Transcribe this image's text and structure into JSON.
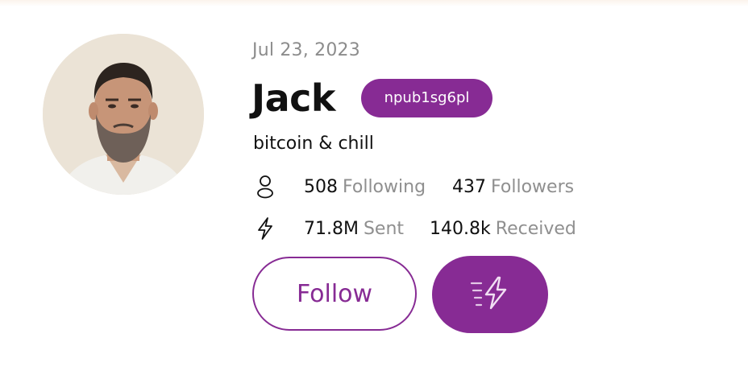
{
  "profile": {
    "date": "Jul 23, 2023",
    "name": "Jack",
    "npub": "npub1sg6pl",
    "bio": "bitcoin & chill"
  },
  "stats": {
    "following_count": "508",
    "following_label": "Following",
    "followers_count": "437",
    "followers_label": "Followers",
    "sent_amount": "71.8M",
    "sent_label": "Sent",
    "received_amount": "140.8k",
    "received_label": "Received"
  },
  "actions": {
    "follow_label": "Follow"
  },
  "icons": {
    "follows": "person-icon",
    "zaps": "lightning-bolt-icon",
    "zap_button": "zap-fast-icon"
  },
  "colors": {
    "accent": "#872b94",
    "text_primary": "#111111",
    "text_muted": "#8f8f8f"
  }
}
